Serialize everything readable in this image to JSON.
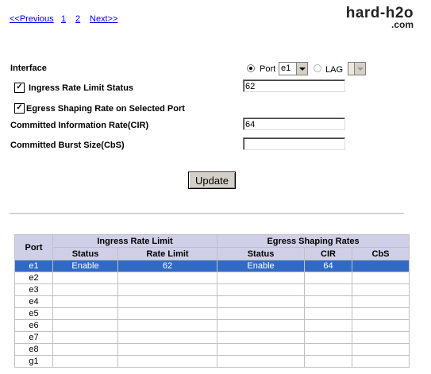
{
  "nav": {
    "previous": "<<Previous",
    "page1": "1",
    "page2": "2",
    "next": "Next>>"
  },
  "watermark": {
    "line1": "hard-h2o",
    "line2": ".com"
  },
  "form": {
    "interface_label": "Interface",
    "port_label": "Port",
    "port_value": "e1",
    "port_selected": true,
    "lag_label": "LAG",
    "lag_value": "",
    "ingress_label": "Ingress Rate Limit Status",
    "ingress_checked": true,
    "ingress_value": "62",
    "egress_label": "Egress Shaping Rate on Selected Port",
    "egress_checked": true,
    "cir_label": "Committed Information Rate(CIR)",
    "cir_value": "64",
    "cbs_label": "Committed Burst Size(CbS)",
    "cbs_value": "",
    "update_button": "Update"
  },
  "table": {
    "group_headers": {
      "port": "Port",
      "ingress": "Ingress Rate Limit",
      "egress": "Egress Shaping Rates"
    },
    "sub_headers": {
      "ingress_status": "Status",
      "ingress_rate": "Rate Limit",
      "egress_status": "Status",
      "cir": "CIR",
      "cbs": "CbS"
    },
    "rows": [
      {
        "port": "e1",
        "ingress_status": "Enable",
        "rate_limit": "62",
        "egress_status": "Enable",
        "cir": "64",
        "cbs": "",
        "selected": true
      },
      {
        "port": "e2",
        "ingress_status": "",
        "rate_limit": "",
        "egress_status": "",
        "cir": "",
        "cbs": ""
      },
      {
        "port": "e3",
        "ingress_status": "",
        "rate_limit": "",
        "egress_status": "",
        "cir": "",
        "cbs": ""
      },
      {
        "port": "e4",
        "ingress_status": "",
        "rate_limit": "",
        "egress_status": "",
        "cir": "",
        "cbs": ""
      },
      {
        "port": "e5",
        "ingress_status": "",
        "rate_limit": "",
        "egress_status": "",
        "cir": "",
        "cbs": ""
      },
      {
        "port": "e6",
        "ingress_status": "",
        "rate_limit": "",
        "egress_status": "",
        "cir": "",
        "cbs": ""
      },
      {
        "port": "e7",
        "ingress_status": "",
        "rate_limit": "",
        "egress_status": "",
        "cir": "",
        "cbs": ""
      },
      {
        "port": "e8",
        "ingress_status": "",
        "rate_limit": "",
        "egress_status": "",
        "cir": "",
        "cbs": ""
      },
      {
        "port": "g1",
        "ingress_status": "",
        "rate_limit": "",
        "egress_status": "",
        "cir": "",
        "cbs": ""
      }
    ]
  }
}
